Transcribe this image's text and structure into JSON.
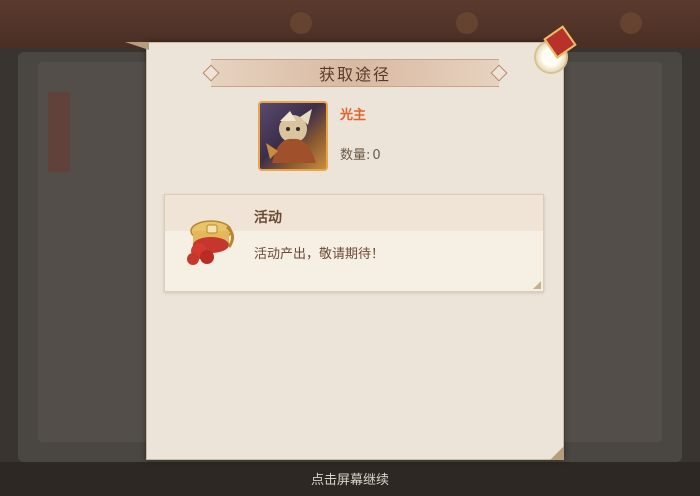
{
  "dialog": {
    "title": "获取途径",
    "item": {
      "name": "光主",
      "quantity_label": "数量:",
      "quantity_value": "0",
      "icon": "character-portrait-icon"
    },
    "sources": [
      {
        "title": "活动",
        "description": "活动产出，敬请期待！",
        "icon": "gift-scroll-icon"
      }
    ],
    "close_icon": "close-seal-icon"
  },
  "footer": {
    "hint": "点击屏幕继续"
  },
  "colors": {
    "item_name": "#e0622e",
    "dialog_bg": "#ece4d8",
    "title_text": "#5a3a28"
  }
}
